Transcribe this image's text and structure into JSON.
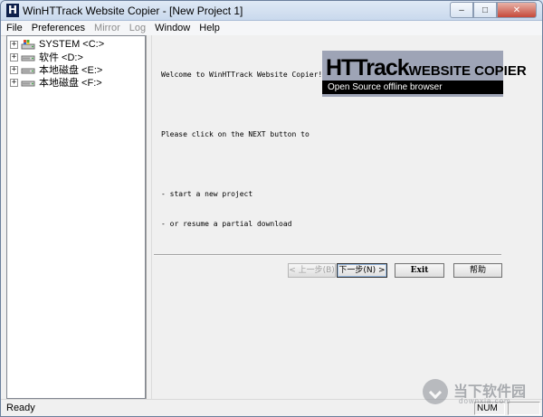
{
  "window": {
    "title": "WinHTTrack Website Copier - [New Project 1]",
    "app_icon_letter": "H",
    "controls": {
      "minimize": "–",
      "maximize": "□",
      "close": "✕"
    }
  },
  "menu": {
    "items": [
      {
        "label": "File",
        "enabled": true
      },
      {
        "label": "Preferences",
        "enabled": true
      },
      {
        "label": "Mirror",
        "enabled": false
      },
      {
        "label": "Log",
        "enabled": false
      },
      {
        "label": "Window",
        "enabled": true
      },
      {
        "label": "Help",
        "enabled": true
      }
    ]
  },
  "tree": {
    "expander_symbol": "+",
    "drives": [
      {
        "label": "SYSTEM <C:>",
        "icon": "system-drive-icon"
      },
      {
        "label": "软件 <D:>",
        "icon": "hard-drive-icon"
      },
      {
        "label": "本地磁盘 <E:>",
        "icon": "hard-drive-icon"
      },
      {
        "label": "本地磁盘 <F:>",
        "icon": "hard-drive-icon"
      }
    ]
  },
  "welcome": {
    "line1": "Welcome to WinHTTrack Website Copier!",
    "line2": "Please click on the NEXT button to",
    "bullet1": "- start a new project",
    "bullet2": "- or resume a partial download"
  },
  "banner": {
    "title_big": "HTTrack",
    "title_small": "WEBSITE COPIER",
    "subtitle": "Open Source offline browser",
    "bg_color": "#9ea4b6"
  },
  "buttons": {
    "prev": "< 上一步(B)",
    "next": "下一步(N) >",
    "exit": "Exit",
    "help": "帮助"
  },
  "status": {
    "text": "Ready",
    "num": "NUM",
    "extra": ""
  },
  "watermark": {
    "text": "当下软件园",
    "sub": "downxia.com"
  }
}
